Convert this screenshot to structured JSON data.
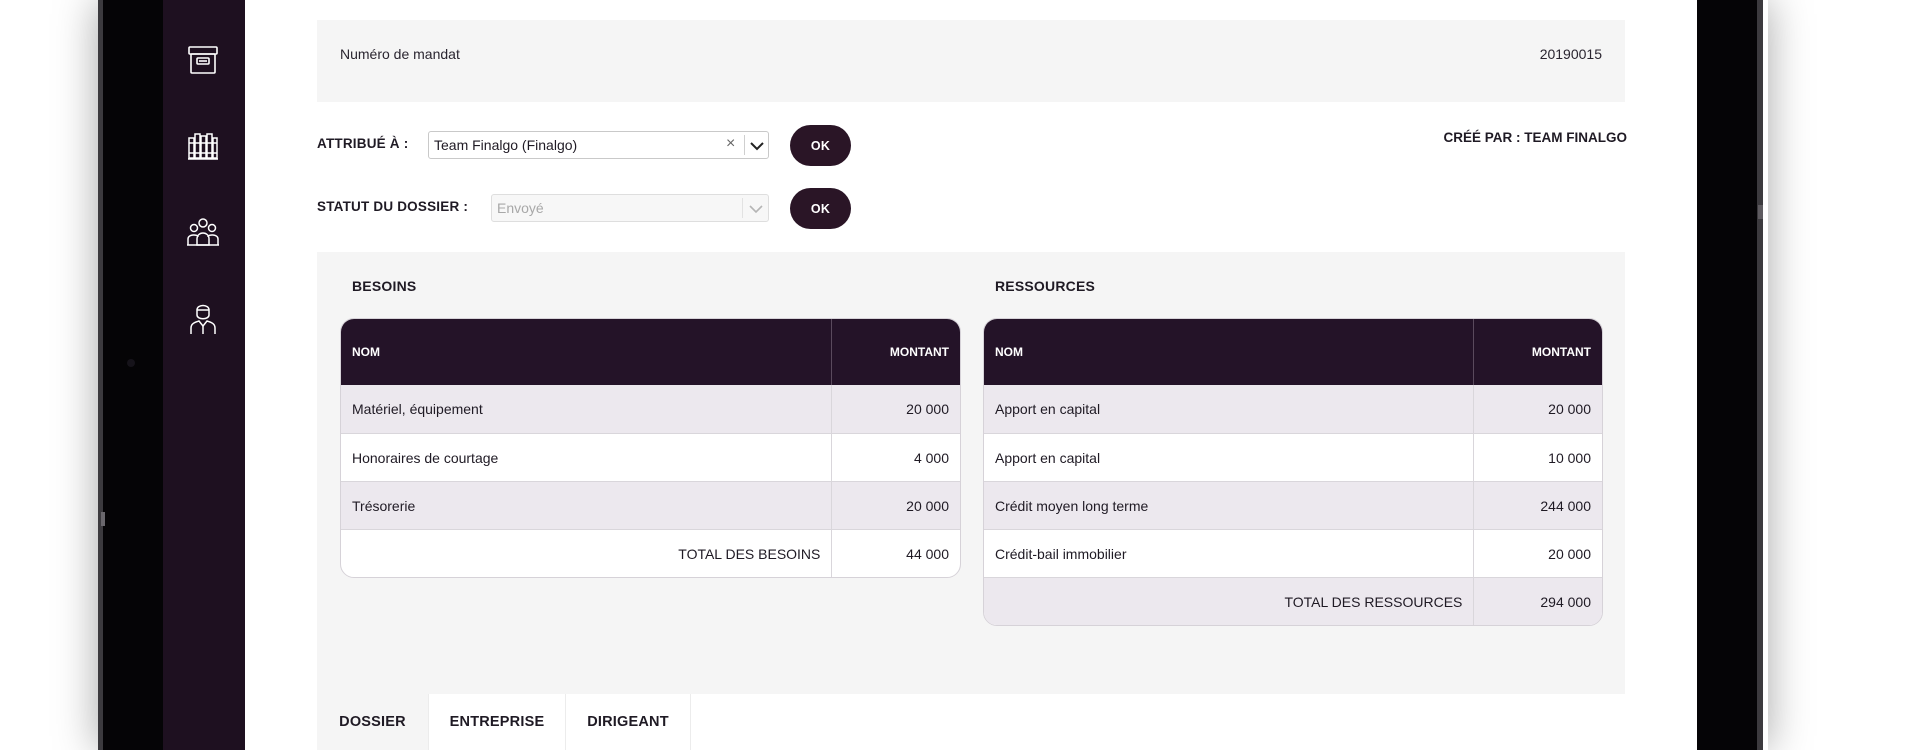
{
  "sidebar": {
    "icons": [
      "archive-box-icon",
      "library-books-icon",
      "team-group-icon",
      "user-profile-icon"
    ]
  },
  "mandat": {
    "label": "Numéro de mandat",
    "value": "20190015"
  },
  "attribue": {
    "label": "ATTRIBUÉ À :",
    "value": "Team Finalgo (Finalgo)",
    "clear": "×",
    "ok_label": "OK"
  },
  "statut": {
    "label": "STATUT DU DOSSIER :",
    "value": "Envoyé",
    "ok_label": "OK"
  },
  "cree_par": "CRÉÉ PAR : TEAM FINALGO",
  "besoins": {
    "title": "BESOINS",
    "headers": {
      "name": "NOM",
      "amount": "MONTANT"
    },
    "rows": [
      {
        "name": "Matériel, équipement",
        "amount": "20 000"
      },
      {
        "name": "Honoraires de courtage",
        "amount": "4 000"
      },
      {
        "name": "Trésorerie",
        "amount": "20 000"
      }
    ],
    "total": {
      "label": "TOTAL DES BESOINS",
      "amount": "44 000"
    }
  },
  "ressources": {
    "title": "RESSOURCES",
    "headers": {
      "name": "NOM",
      "amount": "MONTANT"
    },
    "rows": [
      {
        "name": "Apport en capital",
        "amount": "20 000"
      },
      {
        "name": "Apport en capital",
        "amount": "10 000"
      },
      {
        "name": "Crédit moyen long terme",
        "amount": "244 000"
      },
      {
        "name": "Crédit-bail immobilier",
        "amount": "20 000"
      }
    ],
    "total": {
      "label": "TOTAL DES RESSOURCES",
      "amount": "294 000"
    }
  },
  "tabs": [
    {
      "label": "DOSSIER",
      "active": true
    },
    {
      "label": "ENTREPRISE",
      "active": false
    },
    {
      "label": "DIRIGEANT",
      "active": false
    }
  ],
  "colors": {
    "sidebar": "#1e1020",
    "table_header": "#241328",
    "button": "#2a1526",
    "panel_bg": "#f5f5f5",
    "row_shaded": "#ece8ee"
  }
}
